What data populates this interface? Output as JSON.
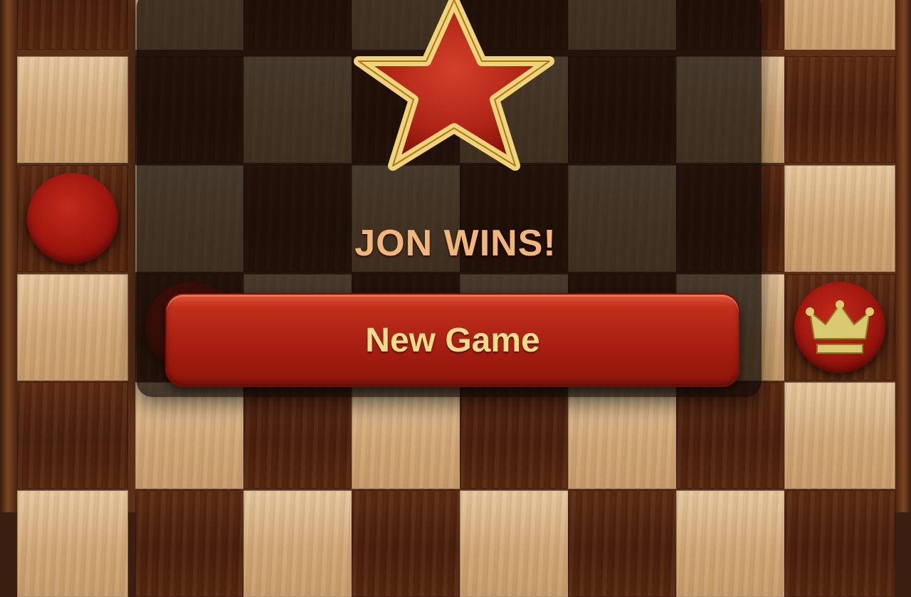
{
  "result": {
    "winner_text": "JON WINS!"
  },
  "actions": {
    "new_game_label": "New Game"
  },
  "icons": {
    "trophy": "star-icon",
    "king": "crown-icon"
  },
  "pieces": [
    {
      "type": "checker",
      "color": "red",
      "row": 2,
      "col": 0
    },
    {
      "type": "checker",
      "color": "red",
      "row": 3,
      "col": 1
    },
    {
      "type": "king",
      "color": "red",
      "row": 3,
      "col": 7
    }
  ],
  "colors": {
    "accent_red": "#a91f12",
    "title_text": "#f2b67a",
    "button_text": "#f0dd8b",
    "star_fill": "#b8281a",
    "star_outline": "#f0d47a"
  }
}
